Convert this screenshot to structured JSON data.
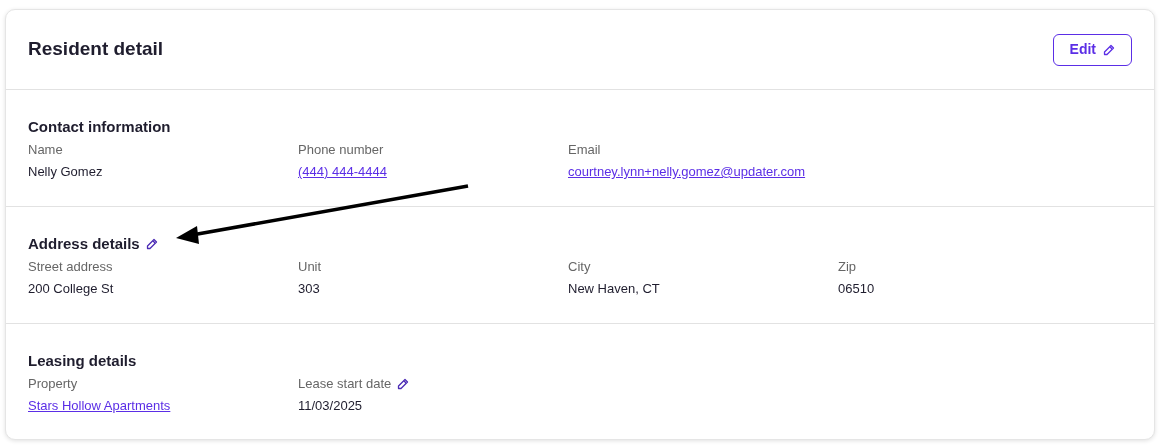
{
  "header": {
    "title": "Resident detail",
    "edit_button": "Edit"
  },
  "sections": [
    {
      "title": "Contact information",
      "editable": false,
      "fields": [
        {
          "label": "Name",
          "value": "Nelly Gomez",
          "kind": "text",
          "editable": false
        },
        {
          "label": "Phone number",
          "value": "(444) 444-4444",
          "kind": "link",
          "editable": false
        },
        {
          "label": "Email",
          "value": "courtney.lynn+nelly.gomez@updater.com",
          "kind": "link",
          "editable": false
        }
      ]
    },
    {
      "title": "Address details",
      "editable": true,
      "fields": [
        {
          "label": "Street address",
          "value": "200 College St",
          "kind": "text",
          "editable": false
        },
        {
          "label": "Unit",
          "value": "303",
          "kind": "text",
          "editable": false
        },
        {
          "label": "City",
          "value": "New Haven, CT",
          "kind": "text",
          "editable": false
        },
        {
          "label": "Zip",
          "value": "06510",
          "kind": "text",
          "editable": false
        }
      ]
    },
    {
      "title": "Leasing details",
      "editable": false,
      "fields": [
        {
          "label": "Property",
          "value": "Stars Hollow Apartments",
          "kind": "link",
          "editable": false
        },
        {
          "label": "Lease start date",
          "value": "11/03/2025",
          "kind": "text",
          "editable": true
        }
      ]
    }
  ],
  "annotation": {
    "kind": "arrow"
  }
}
